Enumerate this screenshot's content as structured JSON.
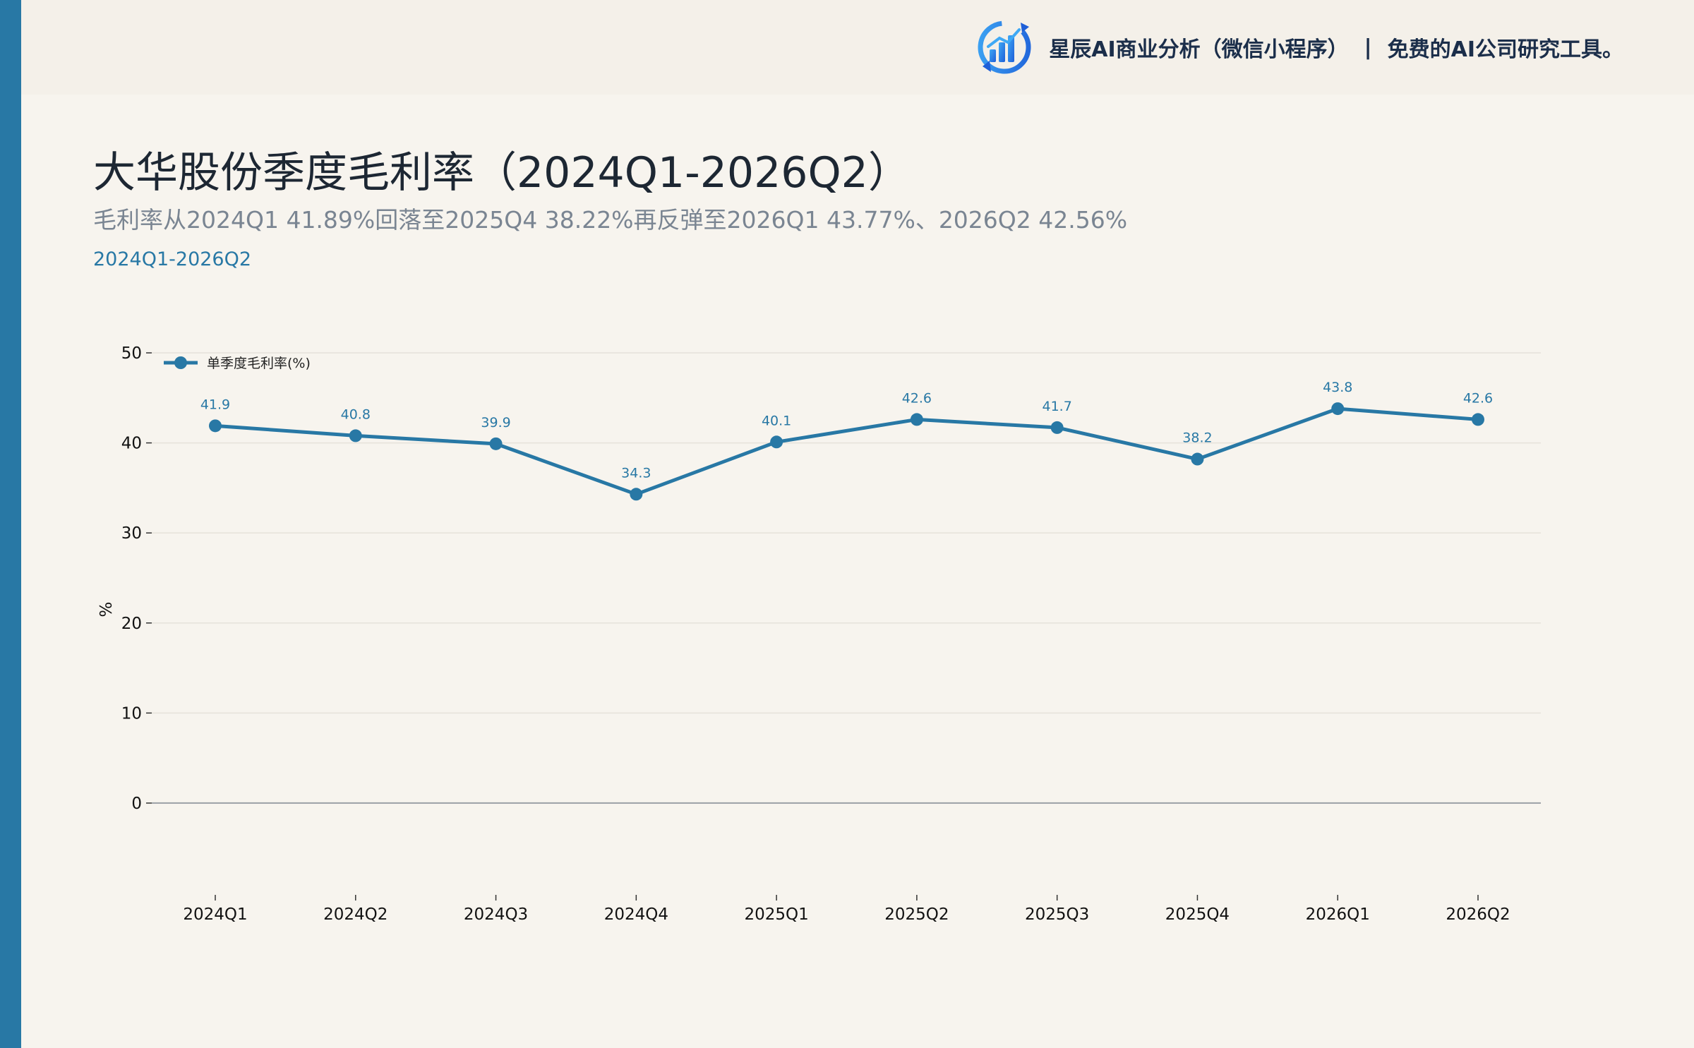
{
  "brand": {
    "icon": "bar-chart-refresh-logo",
    "name": "星辰AI商业分析（微信小程序）",
    "separator": "|",
    "tagline": "免费的AI公司研究工具。"
  },
  "header": {
    "title": "大华股份季度毛利率（2024Q1-2026Q2）",
    "subtitle": "毛利率从2024Q1 41.89%回落至2025Q4 38.22%再反弹至2026Q1 43.77%、2026Q2 42.56%",
    "period": "2024Q1-2026Q2"
  },
  "colors": {
    "accent": "#2878a5",
    "background": "#f7f4ee",
    "band": "#f4f0e9"
  },
  "chart_data": {
    "type": "line",
    "categories": [
      "2024Q1",
      "2024Q2",
      "2024Q3",
      "2024Q4",
      "2025Q1",
      "2025Q2",
      "2025Q3",
      "2025Q4",
      "2026Q1",
      "2026Q2"
    ],
    "series": [
      {
        "name": "单季度毛利率(%)",
        "values": [
          41.9,
          40.8,
          39.9,
          34.3,
          40.1,
          42.6,
          41.7,
          38.2,
          43.8,
          42.6
        ],
        "labels": [
          "41.9",
          "40.8",
          "39.9",
          "34.3",
          "40.1",
          "42.6",
          "41.7",
          "38.2",
          "43.8",
          "42.6"
        ],
        "color": "#2878a5",
        "marker": "circle"
      }
    ],
    "ylabel": "%",
    "ylim": [
      -8,
      50
    ],
    "yticks": [
      0,
      10,
      20,
      30,
      40,
      50
    ],
    "grid": true,
    "legend": "top-left"
  }
}
